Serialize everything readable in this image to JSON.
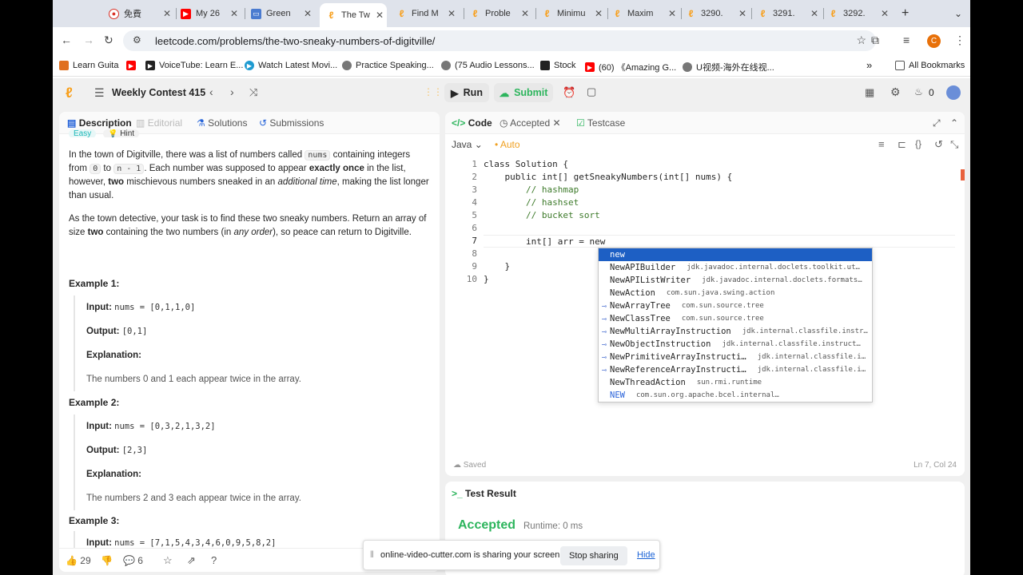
{
  "browser": {
    "tabs": [
      {
        "label": "免費",
        "color": "#d93025",
        "icon": "record-icon"
      },
      {
        "label": "My 26",
        "color": "#ff0000",
        "icon": "youtube-icon"
      },
      {
        "label": "Green",
        "color": "#4a7bd0",
        "icon": "site-icon"
      },
      {
        "label": "The Tw",
        "color": "#f89f1b",
        "icon": "leetcode-icon"
      },
      {
        "label": "Find M",
        "color": "#f89f1b",
        "icon": "leetcode-icon"
      },
      {
        "label": "Proble",
        "color": "#f89f1b",
        "icon": "leetcode-icon"
      },
      {
        "label": "Minimu",
        "color": "#f89f1b",
        "icon": "leetcode-icon"
      },
      {
        "label": "Maxim",
        "color": "#f89f1b",
        "icon": "leetcode-icon"
      },
      {
        "label": "3290.",
        "color": "#f89f1b",
        "icon": "leetcode-icon"
      },
      {
        "label": "3291.",
        "color": "#f89f1b",
        "icon": "leetcode-icon"
      },
      {
        "label": "3292.",
        "color": "#f89f1b",
        "icon": "leetcode-icon"
      }
    ],
    "url": "leetcode.com/problems/the-two-sneaky-numbers-of-digitville/",
    "profile_initial": "C",
    "bookmarks": [
      {
        "label": "Learn Guita",
        "color": "#e07020"
      },
      {
        "label": "",
        "color": "#ff0000"
      },
      {
        "label": "VoiceTube: Learn E...",
        "color": "#222"
      },
      {
        "label": "Watch Latest Movi...",
        "color": "#1f9bd1"
      },
      {
        "label": "Practice Speaking...",
        "color": "#555"
      },
      {
        "label": "(75 Audio Lessons...",
        "color": "#555"
      },
      {
        "label": "Stock",
        "color": "#222"
      },
      {
        "label": "(60) 《Amazing G...",
        "color": "#ff0000"
      },
      {
        "label": "U视频-海外在线视...",
        "color": "#555"
      }
    ],
    "more_bookmarks": "»",
    "all_bookmarks": "All Bookmarks"
  },
  "lc": {
    "contest_title": "Weekly Contest 415",
    "run_label": "Run",
    "submit_label": "Submit",
    "streak_count": "0",
    "left_tabs": [
      "Description",
      "Editorial",
      "Solutions",
      "Submissions"
    ],
    "difficulty_tags": [
      "Easy",
      "Hint"
    ],
    "desc_p1": {
      "a": "In the town of Digitville, there was a list of numbers called ",
      "code1": "nums",
      "b": " containing integers from ",
      "code2": "0",
      "c": " to ",
      "code3": "n - 1",
      "d": ". Each number was supposed to appear ",
      "bold1": "exactly once",
      "e": " in the list, however, ",
      "bold2": "two",
      "f": " mischievous numbers sneaked in an ",
      "ital1": "additional time",
      "g": ", making the list longer than usual."
    },
    "desc_p2": {
      "a": "As the town detective, your task is to find these two sneaky numbers. Return an array of size ",
      "bold1": "two",
      "b": " containing the two numbers (in ",
      "ital1": "any order",
      "c": "), so peace can return to Digitville."
    },
    "examples": [
      {
        "title": "Example 1:",
        "input_label": "Input:",
        "input": "nums = [0,1,1,0]",
        "output_label": "Output:",
        "output": "[0,1]",
        "explanation_label": "Explanation:",
        "explanation": "The numbers 0 and 1 each appear twice in the array."
      },
      {
        "title": "Example 2:",
        "input_label": "Input:",
        "input": "nums = [0,3,2,1,3,2]",
        "output_label": "Output:",
        "output": "[2,3]",
        "explanation_label": "Explanation:",
        "explanation": "The numbers 2 and 3 each appear twice in the array."
      },
      {
        "title": "Example 3:",
        "input_label": "Input:",
        "input": "nums = [7,1,5,4,3,4,6,0,9,5,8,2]"
      }
    ],
    "likes": "29",
    "comments": "6",
    "code_tabs": [
      "Code",
      "Accepted",
      "Testcase"
    ],
    "language": "Java",
    "auto_label": "Auto",
    "code_lines": [
      "class Solution {",
      "    public int[] getSneakyNumbers(int[] nums) {",
      "        // hashmap",
      "        // hashset",
      "        // bucket sort",
      "",
      "        int[] arr = new",
      "",
      "    }",
      "}"
    ],
    "line_numbers": [
      "1",
      "2",
      "3",
      "4",
      "5",
      "6",
      "7",
      "8",
      "9",
      "10"
    ],
    "autocomplete": [
      {
        "name": "new",
        "pkg": ""
      },
      {
        "name": "NewAPIBuilder",
        "pkg": "jdk.javadoc.internal.doclets.toolkit.ut…"
      },
      {
        "name": "NewAPIListWriter",
        "pkg": "jdk.javadoc.internal.doclets.formats…"
      },
      {
        "name": "NewAction",
        "pkg": "com.sun.java.swing.action"
      },
      {
        "name": "NewArrayTree",
        "pkg": "com.sun.source.tree"
      },
      {
        "name": "NewClassTree",
        "pkg": "com.sun.source.tree"
      },
      {
        "name": "NewMultiArrayInstruction",
        "pkg": "jdk.internal.classfile.instr…"
      },
      {
        "name": "NewObjectInstruction",
        "pkg": "jdk.internal.classfile.instruct…"
      },
      {
        "name": "NewPrimitiveArrayInstructi…",
        "pkg": "jdk.internal.classfile.i…"
      },
      {
        "name": "NewReferenceArrayInstructi…",
        "pkg": "jdk.internal.classfile.i…"
      },
      {
        "name": "NewThreadAction",
        "pkg": "sun.rmi.runtime"
      },
      {
        "name": "NEW",
        "pkg": "com.sun.org.apache.bcel.internal…"
      }
    ],
    "saved_label": "Saved",
    "cursor_pos": "Ln 7, Col 24",
    "test_result_label": "Test Result",
    "accepted_label": "Accepted",
    "runtime_label": "Runtime: 0 ms"
  },
  "share": {
    "message": "online-video-cutter.com is sharing your screen.",
    "stop_label": "Stop sharing",
    "hide_label": "Hide"
  },
  "colors": {
    "accent_green": "#2db55d",
    "leetcode_orange": "#f89f1b",
    "selected_blue": "#1d5fc4"
  }
}
